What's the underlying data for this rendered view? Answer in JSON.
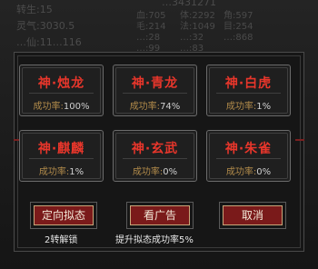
{
  "background": {
    "left_lines": [
      "转生:15",
      "灵气:3030.5",
      "…仙:11…116"
    ],
    "top_number": "…3431271",
    "stats": [
      "血:705",
      "体:2292",
      "角:597",
      "毛:214",
      "法:1049",
      "目:254",
      "…:28",
      "…:32",
      "…:868",
      "…:99",
      "…:83"
    ]
  },
  "cards": [
    {
      "name": "神·烛龙",
      "rate_label": "成功率:",
      "rate": "100%"
    },
    {
      "name": "神·青龙",
      "rate_label": "成功率:",
      "rate": "74%"
    },
    {
      "name": "神·白虎",
      "rate_label": "成功率:",
      "rate": "1%"
    },
    {
      "name": "神·麒麟",
      "rate_label": "成功率:",
      "rate": "1%"
    },
    {
      "name": "神·玄武",
      "rate_label": "成功率:",
      "rate": "0%"
    },
    {
      "name": "神·朱雀",
      "rate_label": "成功率:",
      "rate": "0%"
    }
  ],
  "buttons": {
    "directional": "定向拟态",
    "watch_ad": "看广告",
    "cancel": "取消"
  },
  "captions": {
    "directional": "2转解锁",
    "watch_ad": "提升拟态成功率5%"
  }
}
